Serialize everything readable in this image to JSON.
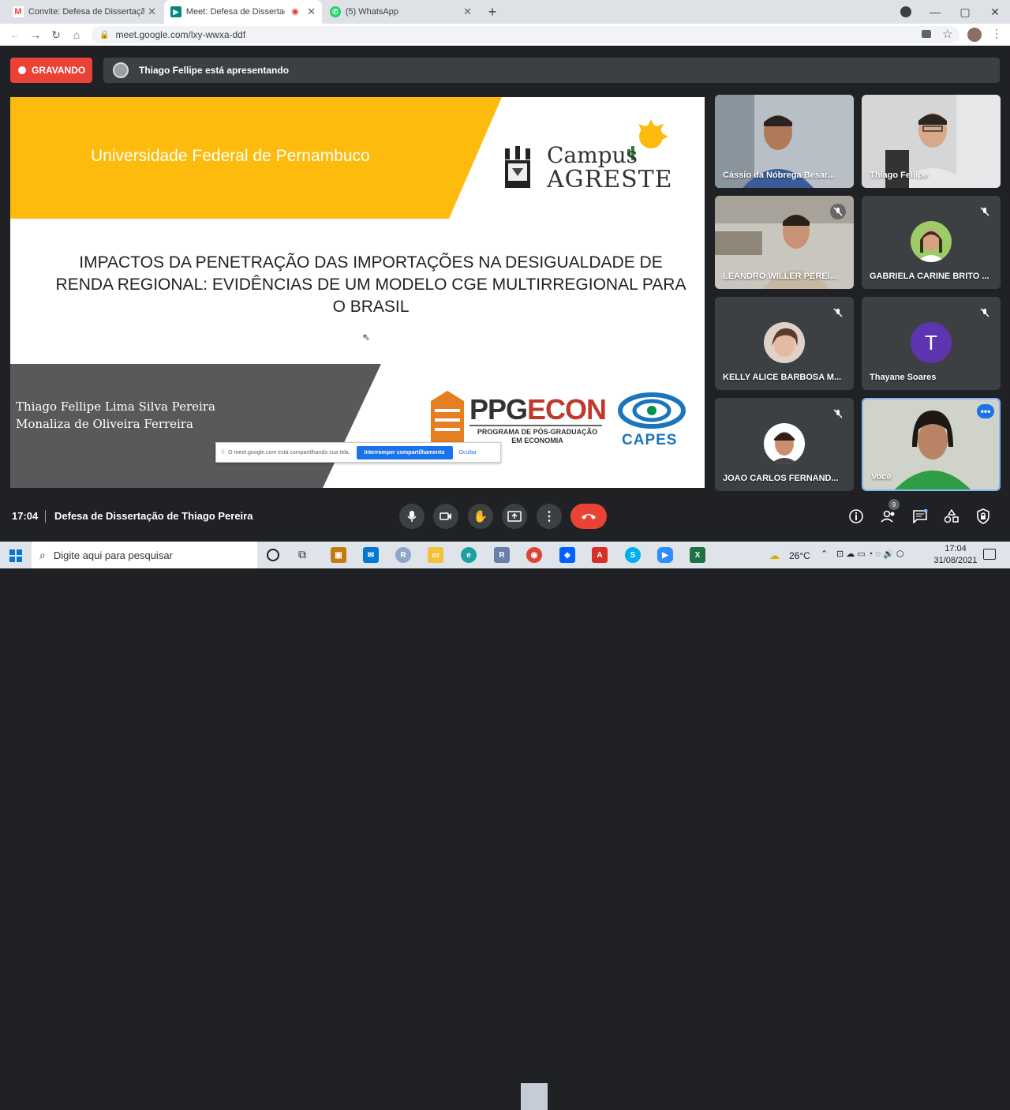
{
  "browser": {
    "tabs": [
      {
        "label": "Convite: Defesa de Dissertação d",
        "favicon": "gmail-icon",
        "color": "#ea4335"
      },
      {
        "label": "Meet: Defesa de Dissertação",
        "favicon": "meet-icon",
        "color": "#00897b"
      },
      {
        "label": "(5) WhatsApp",
        "favicon": "whatsapp-icon",
        "color": "#25d366"
      }
    ],
    "url": "meet.google.com/lxy-wwxa-ddf"
  },
  "meet": {
    "recording_label": "GRAVANDO",
    "presenting_text": "Thiago Fellipe está apresentando",
    "slide": {
      "university": "Universidade Federal de Pernambuco",
      "campus_line1": "Campus",
      "campus_line2": "AGRESTE",
      "title_line1": "IMPACTOS DA PENETRAÇÃO DAS IMPORTAÇÕES NA DESIGUALDADE DE",
      "title_line2": "RENDA REGIONAL: EVIDÊNCIAS DE UM MODELO CGE MULTIRREGIONAL PARA",
      "title_line3": "O BRASIL",
      "author1": "Thiago Fellipe Lima Silva Pereira",
      "author2": "Monaliza de Oliveira Ferreira",
      "ppg": "PPG",
      "econ": "ECON",
      "ppg_sub1": "PROGRAMA DE PÓS-GRADUAÇÃO",
      "ppg_sub2": "EM ECONOMIA",
      "capes": "CAPES"
    },
    "share_bar": {
      "text": "O meet.google.com está compartilhando sua tela.",
      "stop_label": "Interromper compartilhamento",
      "hide_label": "Ocultar"
    },
    "participants": [
      {
        "name": "Cássio da Nóbrega Besar..."
      },
      {
        "name": "Thiago Fellipe"
      },
      {
        "name": "LEANDRO WILLER PEREI..."
      },
      {
        "name": "GABRIELA CARINE BRITO ..."
      },
      {
        "name": "KELLY ALICE BARBOSA M..."
      },
      {
        "name": "Thayane Soares",
        "initial": "T"
      },
      {
        "name": "JOAO CARLOS FERNAND..."
      },
      {
        "name": "Você"
      }
    ],
    "time": "17:04",
    "meeting_name": "Defesa de Dissertação de Thiago Pereira",
    "people_count": "9"
  },
  "taskbar": {
    "search_placeholder": "Digite aqui para pesquisar",
    "temperature": "26°C",
    "clock_time": "17:04",
    "clock_date": "31/08/2021"
  }
}
